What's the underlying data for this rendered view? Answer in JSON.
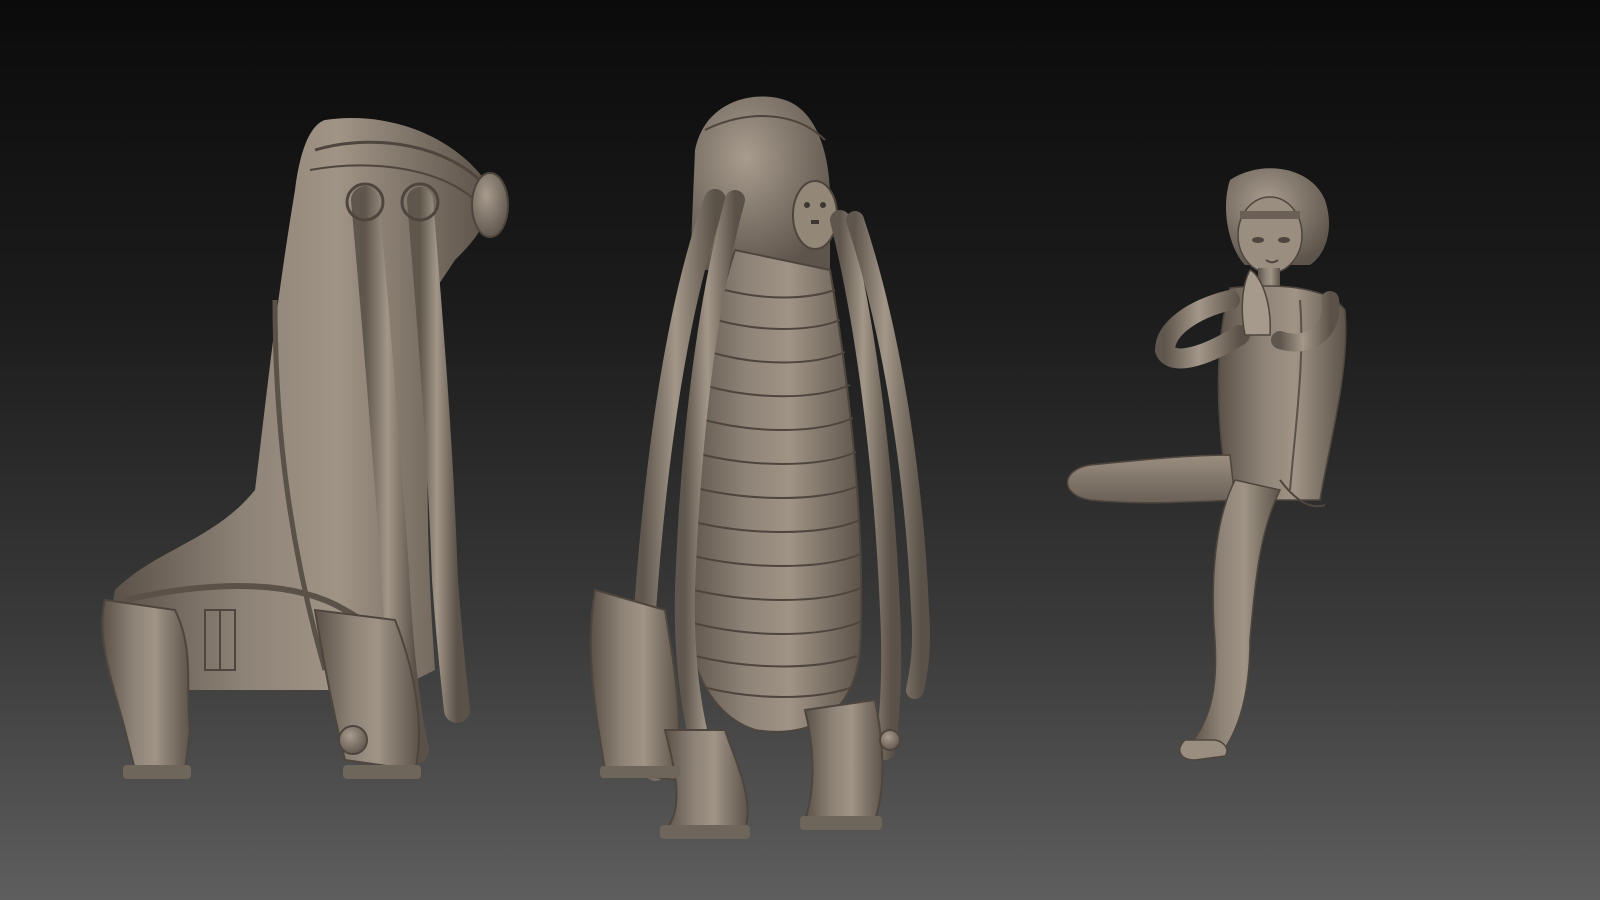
{
  "scene": {
    "background": {
      "top_color": "#0b0b0b",
      "bottom_color": "#5e5e5e"
    },
    "clay_color": "#857a6e",
    "clay_highlight": "#a69a8c",
    "clay_shadow": "#4e463e",
    "figures": [
      {
        "name": "creature-side-view"
      },
      {
        "name": "creature-front-view"
      },
      {
        "name": "seated-girl"
      }
    ]
  }
}
